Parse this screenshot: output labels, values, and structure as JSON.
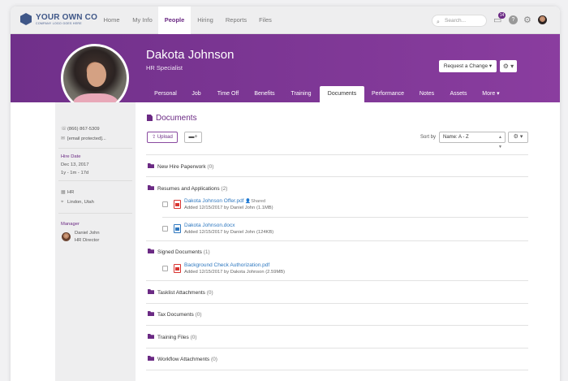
{
  "logo": {
    "name": "YOUR OWN CO",
    "tagline": "COMPANY LOGO GOES HERE"
  },
  "topnav": {
    "items": [
      {
        "label": "Home"
      },
      {
        "label": "My Info"
      },
      {
        "label": "People",
        "active": true
      },
      {
        "label": "Hiring"
      },
      {
        "label": "Reports"
      },
      {
        "label": "Files"
      }
    ],
    "search_placeholder": "Search...",
    "notification_count": "14"
  },
  "profile": {
    "name": "Dakota Johnson",
    "title": "HR Specialist",
    "request_change_label": "Request a Change ▾"
  },
  "tabs": [
    {
      "label": "Personal"
    },
    {
      "label": "Job"
    },
    {
      "label": "Time Off"
    },
    {
      "label": "Benefits"
    },
    {
      "label": "Training"
    },
    {
      "label": "Documents",
      "active": true
    },
    {
      "label": "Performance"
    },
    {
      "label": "Notes"
    },
    {
      "label": "Assets"
    },
    {
      "label": "More ▾"
    }
  ],
  "sidebar": {
    "phone": "(866) 867-5309",
    "email": "[email protected]...",
    "hire_date_label": "Hire Date",
    "hire_date": "Dec 13, 2017",
    "tenure": "1y - 1m - 17d",
    "department": "HR",
    "location": "Lindon, Utah",
    "manager_label": "Manager",
    "manager_name": "Daniel John",
    "manager_title": "HR Director"
  },
  "documents": {
    "title": "Documents",
    "upload_label": "Upload",
    "sort_label": "Sort by",
    "sort_value": "Name: A - Z",
    "folders": [
      {
        "name": "New Hire Paperwork",
        "count": "(0)"
      },
      {
        "name": "Resumes and Applications",
        "count": "(2)"
      },
      {
        "name": "Signed Documents",
        "count": "(1)"
      },
      {
        "name": "Tasklist Attachments",
        "count": "(0)"
      },
      {
        "name": "Tax Documents",
        "count": "(0)"
      },
      {
        "name": "Training Files",
        "count": "(0)"
      },
      {
        "name": "Workflow Attachments",
        "count": "(0)"
      }
    ],
    "files": [
      {
        "name": "Dakota Johnson Offer.pdf",
        "shared": "Shared",
        "meta": "Added 12/15/2017 by Daniel John (1.1MB)",
        "type": "pdf"
      },
      {
        "name": "Dakota Johnson.docx",
        "meta": "Added 12/15/2017 by Daniel John (124KB)",
        "type": "doc"
      },
      {
        "name": "Background Check Authorization.pdf",
        "meta": "Added 12/15/2017 by Dakota Johnson (2.59MB)",
        "type": "pdf"
      }
    ]
  },
  "colors": {
    "brand": "#6b2a84",
    "link": "#2e78c0",
    "pdf": "#d9332f",
    "doc": "#2e78c0"
  },
  "icons": [
    "search-icon",
    "inbox-icon",
    "help-icon",
    "gear-icon",
    "phone-icon",
    "email-icon",
    "building-icon",
    "location-icon",
    "folder-icon",
    "pdf-icon",
    "doc-icon"
  ]
}
